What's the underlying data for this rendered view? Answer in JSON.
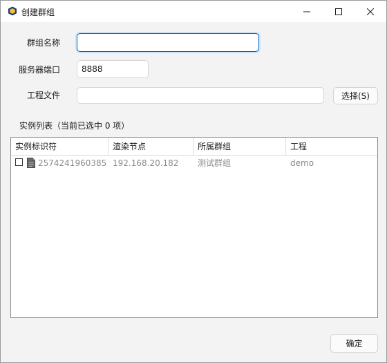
{
  "window": {
    "title": "创建群组",
    "app_icon": "yellow-cube-icon",
    "controls": [
      "minimize-icon",
      "maximize-icon",
      "close-icon"
    ]
  },
  "form": {
    "group_name_label": "群组名称",
    "group_name_value": "",
    "server_port_label": "服务器端口",
    "server_port_value": "8888",
    "project_file_label": "工程文件",
    "project_file_value": "",
    "choose_button_label": "选择(S)"
  },
  "instances": {
    "heading": "实例列表（当前已选中 0 项）",
    "columns": [
      "实例标识符",
      "渲染节点",
      "所属群组",
      "工程"
    ],
    "rows": [
      {
        "checked": false,
        "icon": "document-icon",
        "id": "2574241960385",
        "node": "192.168.20.182",
        "group": "测试群组",
        "project": "demo"
      }
    ]
  },
  "footer": {
    "confirm_label": "确定"
  }
}
